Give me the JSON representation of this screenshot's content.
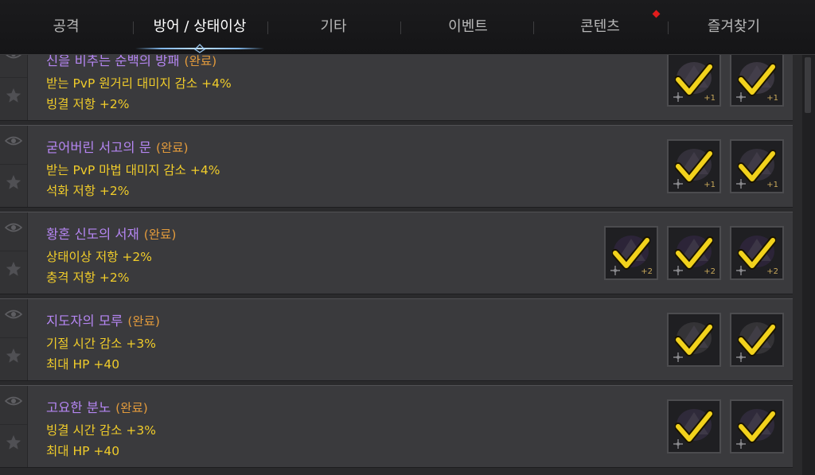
{
  "tabs": [
    {
      "label": "공격"
    },
    {
      "label": "방어 / 상태이상"
    },
    {
      "label": "기타"
    },
    {
      "label": "이벤트"
    },
    {
      "label": "콘텐츠"
    },
    {
      "label": "즐겨찾기"
    }
  ],
  "active_tab": "방어 / 상태이상",
  "colors": {
    "title": "#b586f2",
    "completed": "#e29a3c",
    "stat": "#f0cc2a",
    "check": "#f2d21c",
    "notification": "#e11c1c"
  },
  "collections": [
    {
      "title": "신을 비추는 순백의 방패",
      "status": "(완료)",
      "stats": [
        "받는 PvP 원거리 대미지 감소 +4%",
        "빙결 저항 +2%"
      ],
      "items": [
        {
          "level": "+1",
          "icon": "shield-item-icon"
        },
        {
          "level": "+1",
          "icon": "shield-item-icon"
        }
      ]
    },
    {
      "title": "굳어버린 서고의 문",
      "status": "(완료)",
      "stats": [
        "받는 PvP 마법 대미지 감소 +4%",
        "석화 저항 +2%"
      ],
      "items": [
        {
          "level": "+1",
          "icon": "helmet-item-icon"
        },
        {
          "level": "+1",
          "icon": "helmet-item-icon"
        }
      ]
    },
    {
      "title": "황혼 신도의 서재",
      "status": "(완료)",
      "stats": [
        "상태이상 저항 +2%",
        "충격 저항 +2%"
      ],
      "items": [
        {
          "level": "+2",
          "icon": "book-item-icon"
        },
        {
          "level": "+2",
          "icon": "book-item-icon"
        },
        {
          "level": "+2",
          "icon": "book-item-icon"
        }
      ]
    },
    {
      "title": "지도자의 모루",
      "status": "(완료)",
      "stats": [
        "기절 시간 감소 +3%",
        "최대 HP +40"
      ],
      "items": [
        {
          "level": "",
          "icon": "anvil-item-icon"
        },
        {
          "level": "",
          "icon": "anvil-item-icon"
        }
      ]
    },
    {
      "title": "고요한 분노",
      "status": "(완료)",
      "stats": [
        "빙결 시간 감소 +3%",
        "최대 HP +40"
      ],
      "items": [
        {
          "level": "",
          "icon": "armor-item-icon"
        },
        {
          "level": "",
          "icon": "armor-item-icon"
        }
      ]
    }
  ]
}
